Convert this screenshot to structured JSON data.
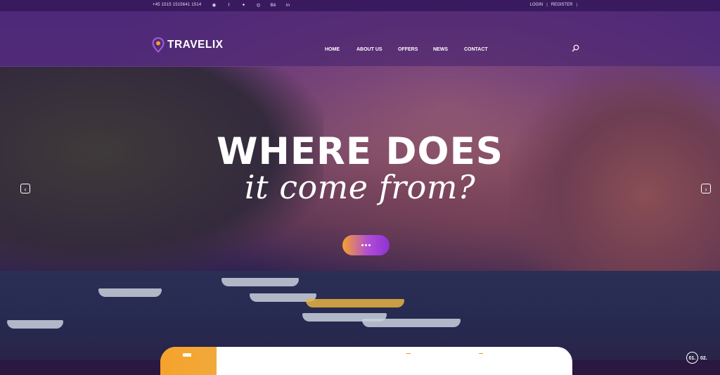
{
  "topbar": {
    "phone": "+45 1515 1515641 1514",
    "social_icons": [
      "pinterest-icon",
      "facebook-icon",
      "twitter-icon",
      "dribbble-icon",
      "behance-icon",
      "linkedin-icon"
    ],
    "login_label": "LOGIN",
    "register_label": "REGISTER",
    "separator": "|"
  },
  "brand": {
    "name": "TRAVELIX",
    "pin_color": "#9b59d8",
    "pin_accent": "#f2a02a"
  },
  "nav": {
    "items": [
      "HOME",
      "ABOUT US",
      "OFFERS",
      "NEWS",
      "CONTACT"
    ]
  },
  "hero": {
    "headline": "WHERE DOES",
    "subheadline": "it come from?",
    "cta_gradient": [
      "#f6a22b",
      "#8d33d2"
    ]
  },
  "colors": {
    "topbar_bg": "#3a1a5e",
    "overlay": "#44206e",
    "accent_orange": "#f6a22b"
  },
  "pager": {
    "current": "01.",
    "next": "02."
  }
}
